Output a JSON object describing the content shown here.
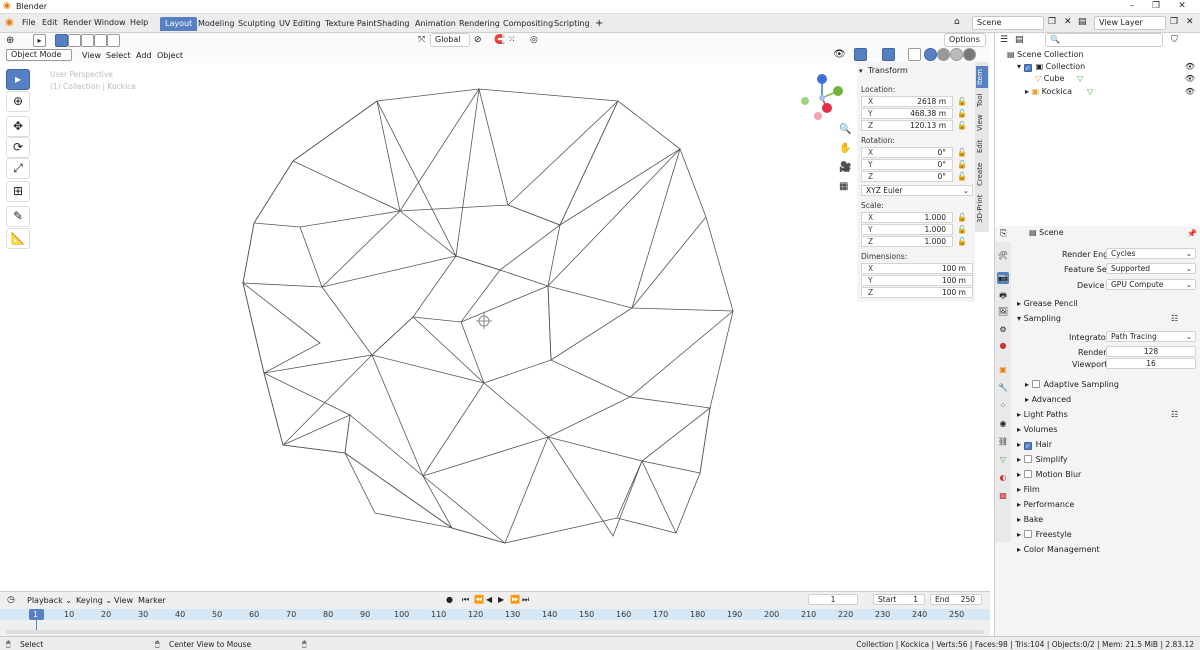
{
  "window": {
    "title": "Blender",
    "min": "–",
    "max": "❐",
    "close": "✕"
  },
  "menus": [
    "File",
    "Edit",
    "Render",
    "Window",
    "Help"
  ],
  "workspaces": [
    "Layout",
    "Modeling",
    "Sculpting",
    "UV Editing",
    "Texture Paint",
    "Shading",
    "Animation",
    "Rendering",
    "Compositing",
    "Scripting"
  ],
  "scene_field": "Scene",
  "view_layer_field": "View Layer",
  "viewport": {
    "mode": "Object Mode",
    "menus": [
      "View",
      "Select",
      "Add",
      "Object"
    ],
    "transform_orientation": "Global",
    "options": "Options",
    "overlay_text_1": "User Perspective",
    "overlay_text_2": "(1) Collection | Kockica"
  },
  "gizmo": {
    "x": "X",
    "y": "Y",
    "z": "Z"
  },
  "npanel": {
    "section": "Transform",
    "location_label": "Location:",
    "location": [
      {
        "axis": "X",
        "value": "2618 m"
      },
      {
        "axis": "Y",
        "value": "468.38 m"
      },
      {
        "axis": "Z",
        "value": "120.13 m"
      }
    ],
    "rotation_label": "Rotation:",
    "rotation": [
      {
        "axis": "X",
        "value": "0°"
      },
      {
        "axis": "Y",
        "value": "0°"
      },
      {
        "axis": "Z",
        "value": "0°"
      }
    ],
    "rotation_mode": "XYZ Euler",
    "scale_label": "Scale:",
    "scale": [
      {
        "axis": "X",
        "value": "1.000"
      },
      {
        "axis": "Y",
        "value": "1.000"
      },
      {
        "axis": "Z",
        "value": "1.000"
      }
    ],
    "dimensions_label": "Dimensions:",
    "dimensions": [
      {
        "axis": "X",
        "value": "100 m"
      },
      {
        "axis": "Y",
        "value": "100 m"
      },
      {
        "axis": "Z",
        "value": "100 m"
      }
    ]
  },
  "vtabs": [
    "Item",
    "Tool",
    "View",
    "Edit",
    "Create",
    "3D-Print"
  ],
  "outliner": {
    "root": "Scene Collection",
    "collection": "Collection",
    "items": [
      "Cube",
      "Kockica"
    ]
  },
  "props": {
    "context": "Scene",
    "render_engine_label": "Render Engine",
    "render_engine": "Cycles",
    "feature_set_label": "Feature Set",
    "feature_set": "Supported",
    "device_label": "Device",
    "device": "GPU Compute",
    "grease_pencil": "Grease Pencil",
    "sampling": "Sampling",
    "integrator_label": "Integrator",
    "integrator": "Path Tracing",
    "render_label": "Render",
    "render_samples": "128",
    "viewport_label": "Viewport",
    "viewport_samples": "16",
    "adaptive_sampling": "Adaptive Sampling",
    "advanced": "Advanced",
    "light_paths": "Light Paths",
    "volumes": "Volumes",
    "hair": "Hair",
    "simplify": "Simplify",
    "motion_blur": "Motion Blur",
    "film": "Film",
    "performance": "Performance",
    "bake": "Bake",
    "freestyle": "Freestyle",
    "color_management": "Color Management"
  },
  "timeline": {
    "menus": [
      "Playback",
      "Keying",
      "View",
      "Marker"
    ],
    "current_frame": "1",
    "start_label": "Start",
    "start": "1",
    "end_label": "End",
    "end": "250",
    "ticks": [
      "1",
      "10",
      "20",
      "30",
      "40",
      "50",
      "60",
      "70",
      "80",
      "90",
      "100",
      "110",
      "120",
      "130",
      "140",
      "150",
      "160",
      "170",
      "180",
      "190",
      "200",
      "210",
      "220",
      "230",
      "240",
      "250"
    ]
  },
  "status": {
    "left": "Select",
    "middle": "Center View to Mouse",
    "right": "Collection | Kockica | Verts:56 | Faces:98 | Tris:104 | Objects:0/2 | Mem: 21.5 MiB | 2.83.12"
  }
}
